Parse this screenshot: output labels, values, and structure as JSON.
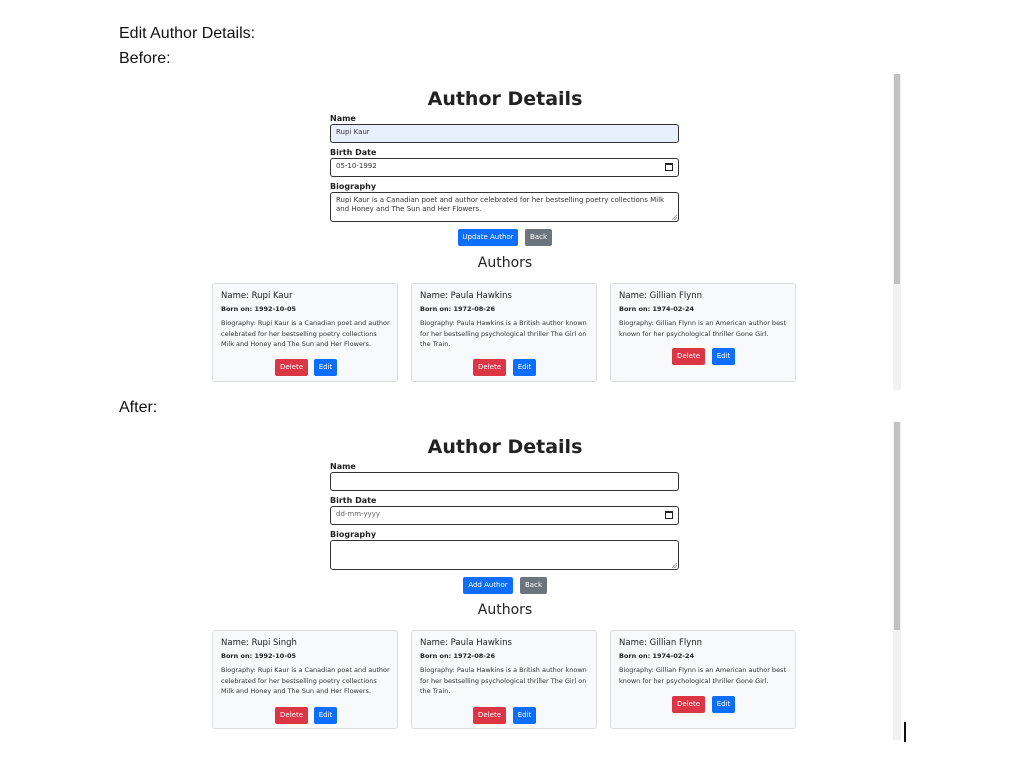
{
  "captions": {
    "title": "Edit Author Details:",
    "before": "Before:",
    "after": "After:"
  },
  "before": {
    "heading": "Author Details",
    "form": {
      "name_label": "Name",
      "name_value": "Rupi Kaur",
      "birth_label": "Birth Date",
      "birth_value": "05-10-1992",
      "bio_label": "Biography",
      "bio_value": "Rupi Kaur is a Canadian poet and author celebrated for her bestselling poetry collections Milk and Honey and The Sun and Her Flowers.",
      "submit_label": "Update Author",
      "back_label": "Back"
    },
    "authors_heading": "Authors",
    "authors": [
      {
        "name": "Name: Rupi Kaur",
        "born": "Born on: 1992-10-05",
        "bio": "Biography: Rupi Kaur is a Canadian poet and author celebrated for her bestselling poetry collections Milk and Honey and The Sun and Her Flowers.",
        "delete": "Delete",
        "edit": "Edit"
      },
      {
        "name": "Name: Paula Hawkins",
        "born": "Born on: 1972-08-26",
        "bio": "Biography: Paula Hawkins is a British author known for her bestselling psychological thriller The Girl on the Train.",
        "delete": "Delete",
        "edit": "Edit"
      },
      {
        "name": "Name: Gillian Flynn",
        "born": "Born on: 1974-02-24",
        "bio": "Biography: Gillian Flynn is an American author best known for her psychological thriller Gone Girl.",
        "delete": "Delete",
        "edit": "Edit"
      }
    ]
  },
  "after": {
    "heading": "Author Details",
    "form": {
      "name_label": "Name",
      "name_value": "",
      "birth_label": "Birth Date",
      "birth_value": "dd-mm-yyyy",
      "bio_label": "Biography",
      "bio_value": "",
      "submit_label": "Add Author",
      "back_label": "Back"
    },
    "authors_heading": "Authors",
    "authors": [
      {
        "name": "Name: Rupi Singh",
        "born": "Born on: 1992-10-05",
        "bio": "Biography: Rupi Kaur is a Canadian poet and author celebrated for her bestselling poetry collections Milk and Honey and The Sun and Her Flowers.",
        "delete": "Delete",
        "edit": "Edit"
      },
      {
        "name": "Name: Paula Hawkins",
        "born": "Born on: 1972-08-26",
        "bio": "Biography: Paula Hawkins is a British author known for her bestselling psychological thriller The Girl on the Train.",
        "delete": "Delete",
        "edit": "Edit"
      },
      {
        "name": "Name: Gillian Flynn",
        "born": "Born on: 1974-02-24",
        "bio": "Biography: Gillian Flynn is an American author best known for her psychological thriller Gone Girl.",
        "delete": "Delete",
        "edit": "Edit"
      }
    ]
  },
  "colors": {
    "primary": "#0d6efd",
    "secondary": "#6c757d",
    "danger": "#dc3545",
    "autofill": "#e8f0fe"
  }
}
